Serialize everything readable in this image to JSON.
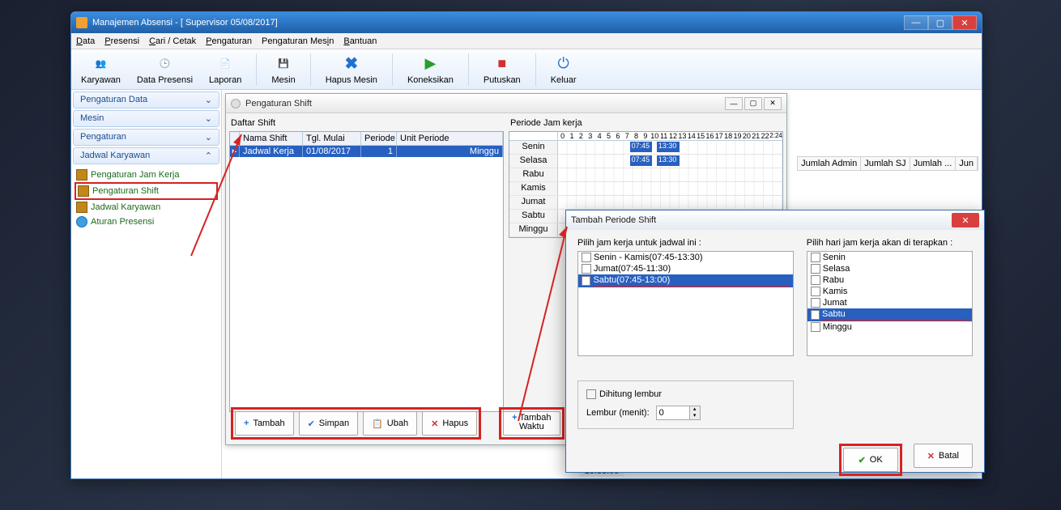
{
  "window": {
    "title": "Manajemen Absensi - [ Supervisor 05/08/2017]"
  },
  "menu": [
    "Data",
    "Presensi",
    "Cari / Cetak",
    "Pengaturan",
    "Pengaturan Mesin",
    "Bantuan"
  ],
  "toolbar": [
    {
      "label": "Karyawan"
    },
    {
      "label": "Data Presensi"
    },
    {
      "label": "Laporan"
    },
    {
      "sep": true
    },
    {
      "label": "Mesin"
    },
    {
      "sep": true
    },
    {
      "label": "Hapus Mesin"
    },
    {
      "sep": true
    },
    {
      "label": "Koneksikan"
    },
    {
      "sep": true
    },
    {
      "label": "Putuskan"
    },
    {
      "sep": true
    },
    {
      "label": "Keluar"
    }
  ],
  "sidebar": {
    "sections": [
      {
        "title": "Pengaturan Data",
        "expanded": false
      },
      {
        "title": "Mesin",
        "expanded": false
      },
      {
        "title": "Pengaturan",
        "expanded": false
      },
      {
        "title": "Jadwal Karyawan",
        "expanded": true,
        "items": [
          {
            "label": "Pengaturan Jam Kerja"
          },
          {
            "label": "Pengaturan Shift",
            "highlight": true
          },
          {
            "label": "Jadwal Karyawan"
          },
          {
            "label": "Aturan Presensi",
            "iconColor": "#3aa0e0"
          }
        ]
      }
    ]
  },
  "shiftWindow": {
    "title": "Pengaturan Shift",
    "daftarLabel": "Daftar Shift",
    "periodeLabel": "Periode Jam kerja",
    "columns": [
      "Nama Shift",
      "Tgl. Mulai",
      "Periode",
      "Unit Periode"
    ],
    "row": {
      "nama": "Jadwal Kerja",
      "tgl": "01/08/2017",
      "periode": "1",
      "unit": "Minggu"
    },
    "days": [
      "Senin",
      "Selasa",
      "Rabu",
      "Kamis",
      "Jumat",
      "Sabtu",
      "Minggu"
    ],
    "bars": [
      {
        "day": 0,
        "label1": "07:45",
        "label2": "13:30"
      },
      {
        "day": 1,
        "label1": "07:45",
        "label2": "13:30"
      }
    ],
    "buttons": {
      "tambah": "Tambah",
      "simpan": "Simpan",
      "ubah": "Ubah",
      "hapus": "Hapus",
      "tambahWaktu": "Tambah\nWaktu"
    }
  },
  "dialog": {
    "title": "Tambah Periode Shift",
    "leftLabel": "Pilih jam kerja untuk jadwal ini :",
    "rightLabel": "Pilih hari jam kerja akan di terapkan :",
    "jamKerja": [
      {
        "label": "Senin - Kamis(07:45-13:30)",
        "checked": false
      },
      {
        "label": "Jumat(07:45-11:30)",
        "checked": false
      },
      {
        "label": "Sabtu(07:45-13:00)",
        "checked": true,
        "selected": true,
        "underline": true
      }
    ],
    "hari": [
      {
        "label": "Senin",
        "checked": false
      },
      {
        "label": "Selasa",
        "checked": false
      },
      {
        "label": "Rabu",
        "checked": false
      },
      {
        "label": "Kamis",
        "checked": false
      },
      {
        "label": "Jumat",
        "checked": false
      },
      {
        "label": "Sabtu",
        "checked": true,
        "selected": true,
        "underline": true
      },
      {
        "label": "Minggu",
        "checked": false
      }
    ],
    "lemburCheck": "Dihitung lembur",
    "lemburLabel": "Lembur (menit):",
    "lemburValue": "0",
    "ok": "OK",
    "batal": "Batal"
  },
  "contentHeaders": [
    "Jumlah Admin",
    "Jumlah SJ",
    "Jumlah ...",
    "Jun"
  ],
  "statusTime": "13:33:05"
}
